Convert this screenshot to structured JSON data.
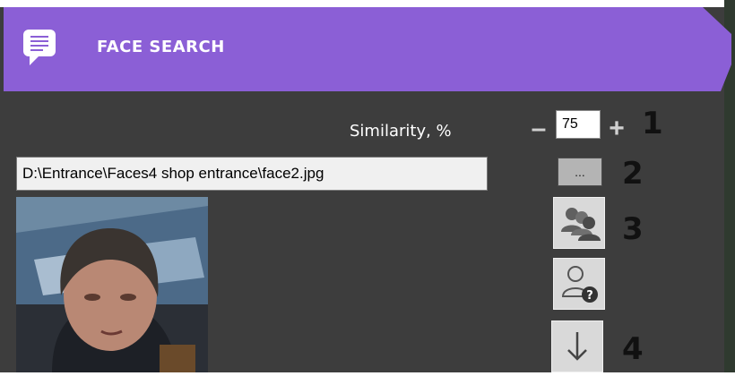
{
  "header": {
    "title": "FACE SEARCH",
    "icon": "message-icon"
  },
  "similarity": {
    "label": "Similarity, %",
    "value": "75",
    "decrement": "–",
    "increment": "+"
  },
  "file": {
    "path": "D:\\Entrance\\Faces4 shop entrance\\face2.jpg",
    "browse_label": "..."
  },
  "buttons": {
    "group_search_icon": "people-group-icon",
    "unknown_person_icon": "person-question-icon",
    "down_icon": "arrow-down-icon"
  },
  "callouts": [
    "1",
    "2",
    "3",
    "4"
  ],
  "colors": {
    "header": "#8b5fd6",
    "panel": "#3d3d3d"
  }
}
